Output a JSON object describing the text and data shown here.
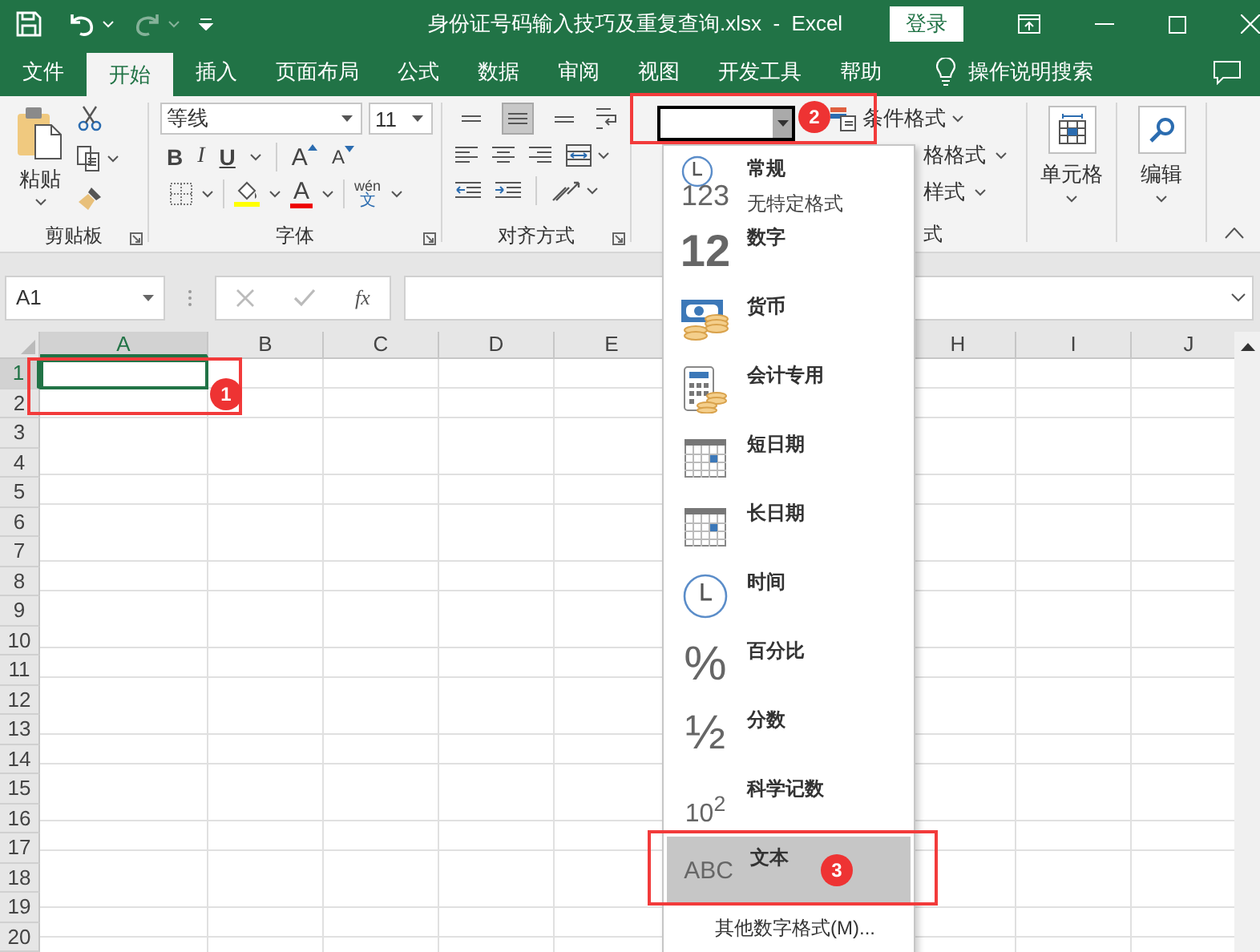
{
  "title_bar": {
    "title": "身份证号码输入技巧及重复查询.xlsx  -  Excel",
    "sign_in": "登录",
    "redo_disabled": true
  },
  "tabs": [
    {
      "label": "文件",
      "selected": false
    },
    {
      "label": "开始",
      "selected": true
    },
    {
      "label": "插入",
      "selected": false
    },
    {
      "label": "页面布局",
      "selected": false
    },
    {
      "label": "公式",
      "selected": false
    },
    {
      "label": "数据",
      "selected": false
    },
    {
      "label": "审阅",
      "selected": false
    },
    {
      "label": "视图",
      "selected": false
    },
    {
      "label": "开发工具",
      "selected": false
    },
    {
      "label": "帮助",
      "selected": false
    }
  ],
  "tell_me": "操作说明搜索",
  "clipboard": {
    "paste": "粘贴",
    "label": "剪贴板"
  },
  "font": {
    "name": "等线",
    "size": "11",
    "bold": "B",
    "italic": "I",
    "underline": "U",
    "grow": "A",
    "shrink": "A",
    "font_color": "A",
    "phonetic_top": "wén",
    "phonetic_bottom": "文",
    "label": "字体"
  },
  "alignment": {
    "vertical": [
      {
        "kind": "top",
        "on": false
      },
      {
        "kind": "middle",
        "on": true
      },
      {
        "kind": "bottom",
        "on": false
      }
    ],
    "label": "对齐方式"
  },
  "styles": {
    "conditional": "条件格式",
    "table_partial": "格格式",
    "cell_partial": "样式",
    "label_partial": "式"
  },
  "cells": {
    "label": "单元格"
  },
  "editing": {
    "label": "编辑"
  },
  "formula_bar": {
    "name_box": "A1",
    "fx": "fx"
  },
  "sheet": {
    "columns_left": [
      {
        "label": "A",
        "selected": true
      },
      {
        "label": "B",
        "selected": false
      },
      {
        "label": "C",
        "selected": false
      },
      {
        "label": "D",
        "selected": false
      },
      {
        "label": "E",
        "selected": false
      }
    ],
    "columns_right": [
      {
        "label": "H",
        "selected": false
      },
      {
        "label": "I",
        "selected": false
      },
      {
        "label": "J",
        "selected": false
      }
    ],
    "rows": [
      {
        "label": "1",
        "selected": true
      },
      {
        "label": "2",
        "selected": false
      },
      {
        "label": "3",
        "selected": false
      },
      {
        "label": "4",
        "selected": false
      },
      {
        "label": "5",
        "selected": false
      },
      {
        "label": "6",
        "selected": false
      },
      {
        "label": "7",
        "selected": false
      },
      {
        "label": "8",
        "selected": false
      },
      {
        "label": "9",
        "selected": false
      },
      {
        "label": "10",
        "selected": false
      },
      {
        "label": "11",
        "selected": false
      },
      {
        "label": "12",
        "selected": false
      },
      {
        "label": "13",
        "selected": false
      },
      {
        "label": "14",
        "selected": false
      },
      {
        "label": "15",
        "selected": false
      },
      {
        "label": "16",
        "selected": false
      },
      {
        "label": "17",
        "selected": false
      },
      {
        "label": "18",
        "selected": false
      },
      {
        "label": "19",
        "selected": false
      },
      {
        "label": "20",
        "selected": false
      }
    ]
  },
  "format_menu": {
    "items": [
      {
        "kind": "general",
        "glyph": "123",
        "label": "常规",
        "description": "无特定格式",
        "selected": false
      },
      {
        "kind": "number",
        "glyph": "12",
        "label": "数字",
        "selected": false
      },
      {
        "kind": "currency",
        "label": "货币",
        "selected": false
      },
      {
        "kind": "accounting",
        "label": "会计专用",
        "selected": false
      },
      {
        "kind": "calendar",
        "label": "短日期",
        "selected": false
      },
      {
        "kind": "calendar",
        "label": "长日期",
        "selected": false
      },
      {
        "kind": "clock",
        "label": "时间",
        "selected": false
      },
      {
        "kind": "percent",
        "glyph": "%",
        "label": "百分比",
        "selected": false
      },
      {
        "kind": "fraction",
        "glyph": "½",
        "label": "分数",
        "selected": false
      },
      {
        "kind": "scientific",
        "glyph": "10$^{2}$",
        "label": "科学记数",
        "selected": false
      },
      {
        "kind": "text",
        "glyph": "ABC",
        "label": "文本",
        "selected": true
      }
    ],
    "more": "其他数字格式(M)..."
  },
  "annotations": [
    {
      "label": "1"
    },
    {
      "label": "2"
    },
    {
      "label": "3"
    }
  ]
}
